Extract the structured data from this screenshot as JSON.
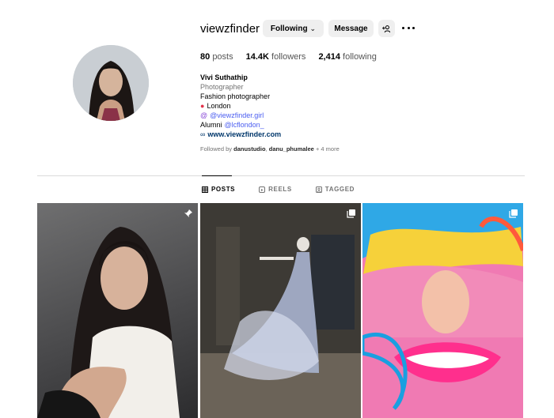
{
  "profile": {
    "username": "viewzfinder",
    "following_label": "Following",
    "message_label": "Message"
  },
  "stats": {
    "posts_count": "80",
    "posts_label": "posts",
    "followers_count": "14.4K",
    "followers_label": "followers",
    "following_count": "2,414",
    "following_label": "following"
  },
  "bio": {
    "name": "Vivi Suthathip",
    "category": "Photographer",
    "line1": "Fashion photographer",
    "location": "London",
    "threads_handle": "@viewzfinder.girl",
    "alumni_prefix": "Alumni",
    "alumni_handle": "@lcflondon_",
    "website": "www.viewzfinder.com"
  },
  "followed_by": {
    "prefix": "Followed by",
    "user1": "danustudio",
    "separator": ",",
    "user2": "danu_phumalee",
    "suffix": "+ 4 more"
  },
  "tabs": [
    {
      "label": "POSTS",
      "icon": "grid-icon",
      "active": true
    },
    {
      "label": "REELS",
      "icon": "reels-icon",
      "active": false
    },
    {
      "label": "TAGGED",
      "icon": "tagged-icon",
      "active": false
    }
  ],
  "posts": [
    {
      "badge": "pin-icon"
    },
    {
      "badge": "carousel-icon"
    },
    {
      "badge": "carousel-icon"
    }
  ],
  "colors": {
    "link": "#4a5df0",
    "website": "#00376b",
    "muted": "#737373",
    "button_bg": "#efefef"
  }
}
